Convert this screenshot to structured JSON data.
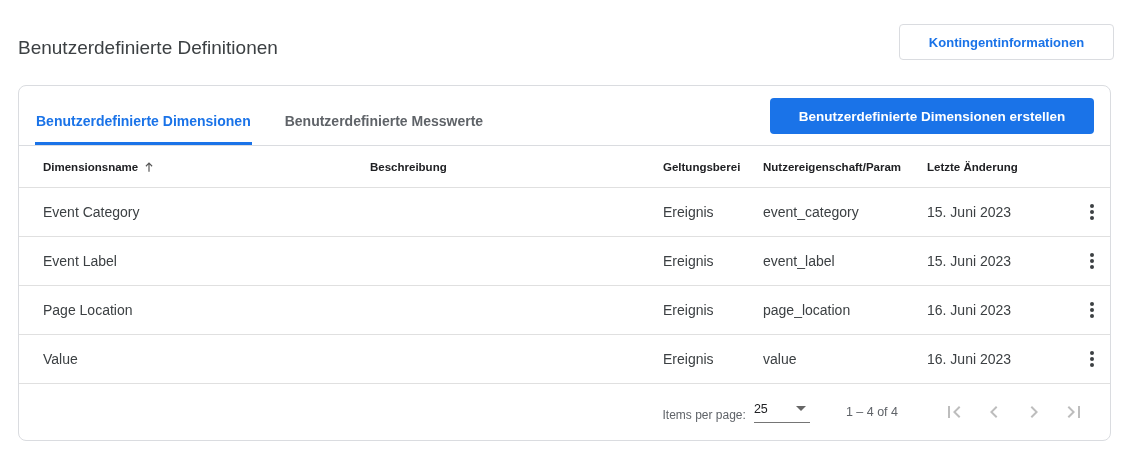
{
  "page": {
    "title": "Benutzerdefinierte Definitionen",
    "quota_button": "Kontingentinformationen"
  },
  "tabs": [
    {
      "label": "Benutzerdefinierte Dimensionen",
      "selected": true
    },
    {
      "label": "Benutzerdefinierte Messwerte",
      "selected": false
    }
  ],
  "create_button": "Benutzerdefinierte Dimensionen erstellen",
  "table": {
    "columns": [
      {
        "label": "Dimensionsname",
        "sorted": true
      },
      {
        "label": "Beschreibung",
        "sorted": false
      },
      {
        "label": "Geltungsberei",
        "sorted": false
      },
      {
        "label": "Nutzereigenschaft/Param",
        "sorted": false
      },
      {
        "label": "Letzte Änderung",
        "sorted": false
      }
    ],
    "rows": [
      {
        "cells": [
          "Event Category",
          "",
          "Ereignis",
          "event_category",
          "15. Juni 2023"
        ]
      },
      {
        "cells": [
          "Event Label",
          "",
          "Ereignis",
          "event_label",
          "15. Juni 2023"
        ]
      },
      {
        "cells": [
          "Page Location",
          "",
          "Ereignis",
          "page_location",
          "16. Juni 2023"
        ]
      },
      {
        "cells": [
          "Value",
          "",
          "Ereignis",
          "value",
          "16. Juni 2023"
        ]
      }
    ]
  },
  "paginator": {
    "items_per_page_label": "Items per page:",
    "page_size": "25",
    "range": "1 – 4 of 4",
    "nav": [
      {
        "kind": "first",
        "disabled": true
      },
      {
        "kind": "prev",
        "disabled": true
      },
      {
        "kind": "next",
        "disabled": true
      },
      {
        "kind": "last",
        "disabled": true
      }
    ]
  }
}
